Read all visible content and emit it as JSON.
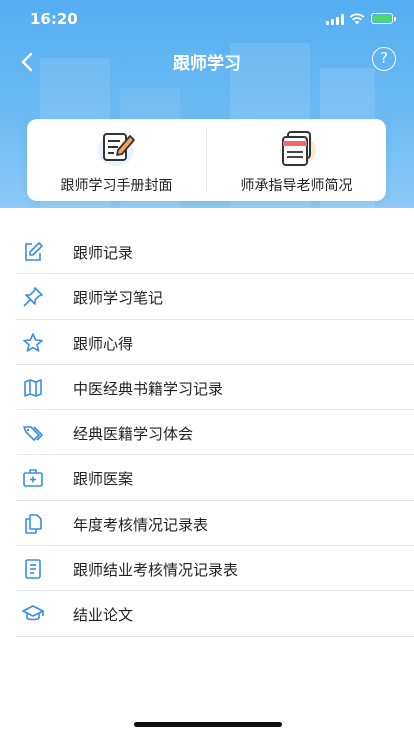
{
  "status_bar": {
    "time": "16:20"
  },
  "nav": {
    "title": "跟师学习",
    "help_label": "?"
  },
  "cards": [
    {
      "label": "跟师学习手册封面",
      "icon": "notebook-pencil-icon"
    },
    {
      "label": "师承指导老师简况",
      "icon": "documents-icon"
    }
  ],
  "menu": [
    {
      "label": "跟师记录",
      "icon": "edit-icon"
    },
    {
      "label": "跟师学习笔记",
      "icon": "pin-icon"
    },
    {
      "label": "跟师心得",
      "icon": "star-icon"
    },
    {
      "label": "中医经典书籍学习记录",
      "icon": "map-icon"
    },
    {
      "label": "经典医籍学习体会",
      "icon": "tag-icon"
    },
    {
      "label": "跟师医案",
      "icon": "medical-kit-icon"
    },
    {
      "label": "年度考核情况记录表",
      "icon": "copy-document-icon"
    },
    {
      "label": "跟师结业考核情况记录表",
      "icon": "document-icon"
    },
    {
      "label": "结业论文",
      "icon": "graduation-cap-icon"
    }
  ],
  "colors": {
    "header": "#55aef2",
    "icon": "#3a8ee6",
    "card_icon_accent": "#f5a35a"
  }
}
